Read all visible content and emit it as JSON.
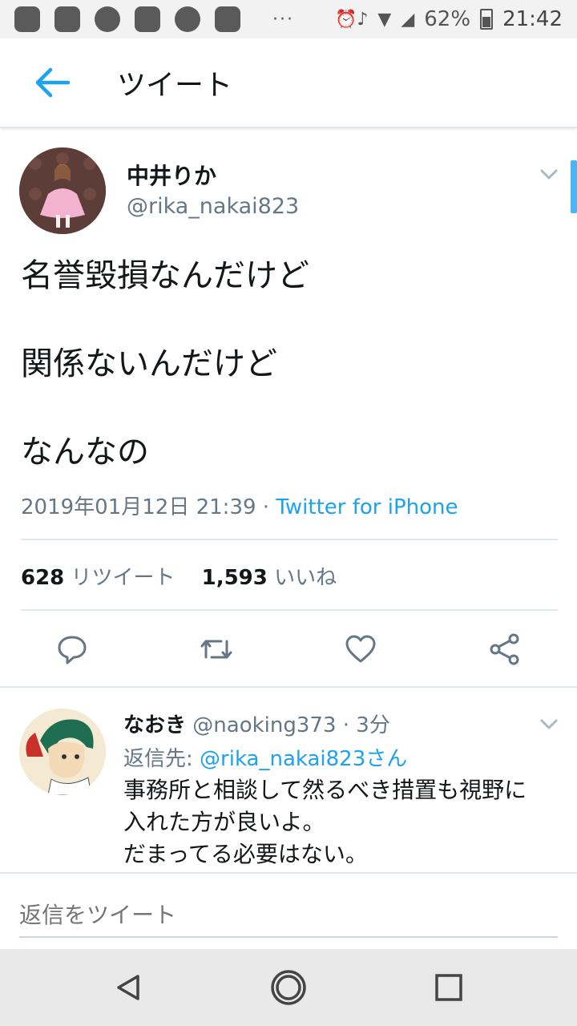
{
  "status_bar": {
    "battery": "62%",
    "time": "21:42",
    "dots": "···"
  },
  "header": {
    "title": "ツイート"
  },
  "tweet": {
    "name": "中井りか",
    "handle": "@rika_nakai823",
    "text": [
      "名誉毀損なんだけど",
      "関係ないんだけど",
      "なんなの"
    ],
    "timestamp": "2019年01月12日 21:39 · ",
    "source": "Twitter for iPhone",
    "retweet_count": "628",
    "retweet_label": "リツイート",
    "like_count": "1,593",
    "like_label": "いいね"
  },
  "reply": {
    "name": "なおき",
    "handle": "@naoking373",
    "time": "· 3分",
    "reply_to_label": "返信先: ",
    "reply_to_handle": "@rika_nakai823さん",
    "text": [
      "事務所と相談して然るべき措置も視野に",
      "入れた方が良いよ。",
      "だまってる必要はない。"
    ]
  },
  "compose": {
    "placeholder": "返信をツイート"
  },
  "icons": {
    "back": "arrow-left-icon",
    "reply": "reply-icon",
    "retweet": "retweet-icon",
    "like": "heart-icon",
    "share": "share-icon",
    "more": "chevron-down-icon",
    "nav_back": "triangle-back-icon",
    "nav_home": "circle-home-icon",
    "nav_recents": "square-recents-icon"
  },
  "colors": {
    "accent": "#1da1f2",
    "secondary_text": "#657786",
    "divider": "#e1e8ed"
  }
}
